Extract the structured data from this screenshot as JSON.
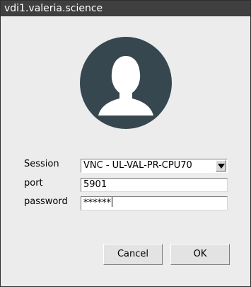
{
  "window": {
    "title": "vdi1.valeria.science"
  },
  "avatar": {
    "icon": "user-silhouette-icon",
    "circle_color": "#37474f",
    "figure_color": "#ffffff"
  },
  "form": {
    "session_label": "Session",
    "session_value": "VNC - UL-VAL-PR-CPU70",
    "port_label": "port",
    "port_value": "5901",
    "password_label": "password",
    "password_mask": "******"
  },
  "buttons": {
    "cancel": "Cancel",
    "ok": "OK"
  }
}
